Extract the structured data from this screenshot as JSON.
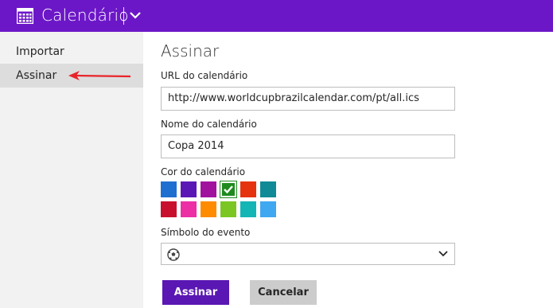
{
  "header": {
    "app_title": "Calendário",
    "app_icon": "calendar-icon",
    "menu_icon": "chevron-down-icon",
    "accent_color": "#6c17c7"
  },
  "sidebar": {
    "items": [
      {
        "label": "Importar",
        "active": false
      },
      {
        "label": "Assinar",
        "active": true
      }
    ],
    "annotation_icon": "red-arrow-icon"
  },
  "form": {
    "title": "Assinar",
    "url_label": "URL do calendário",
    "url_value": "http://www.worldcupbrazilcalendar.com/pt/all.ics",
    "name_label": "Nome do calendário",
    "name_value": "Copa 2014",
    "color_label": "Cor do calendário",
    "colors": [
      "#1f6fd0",
      "#5b17b5",
      "#a0129e",
      "#1e8a1e",
      "#e5330f",
      "#0f8a96",
      "#c8102e",
      "#ec2fa5",
      "#ff8c00",
      "#7cc623",
      "#14b5b5",
      "#3fa8f0"
    ],
    "selected_color": "#1e8a1e",
    "symbol_label": "Símbolo do evento",
    "symbol_icon": "soccer-ball-icon",
    "submit_label": "Assinar",
    "cancel_label": "Cancelar"
  }
}
